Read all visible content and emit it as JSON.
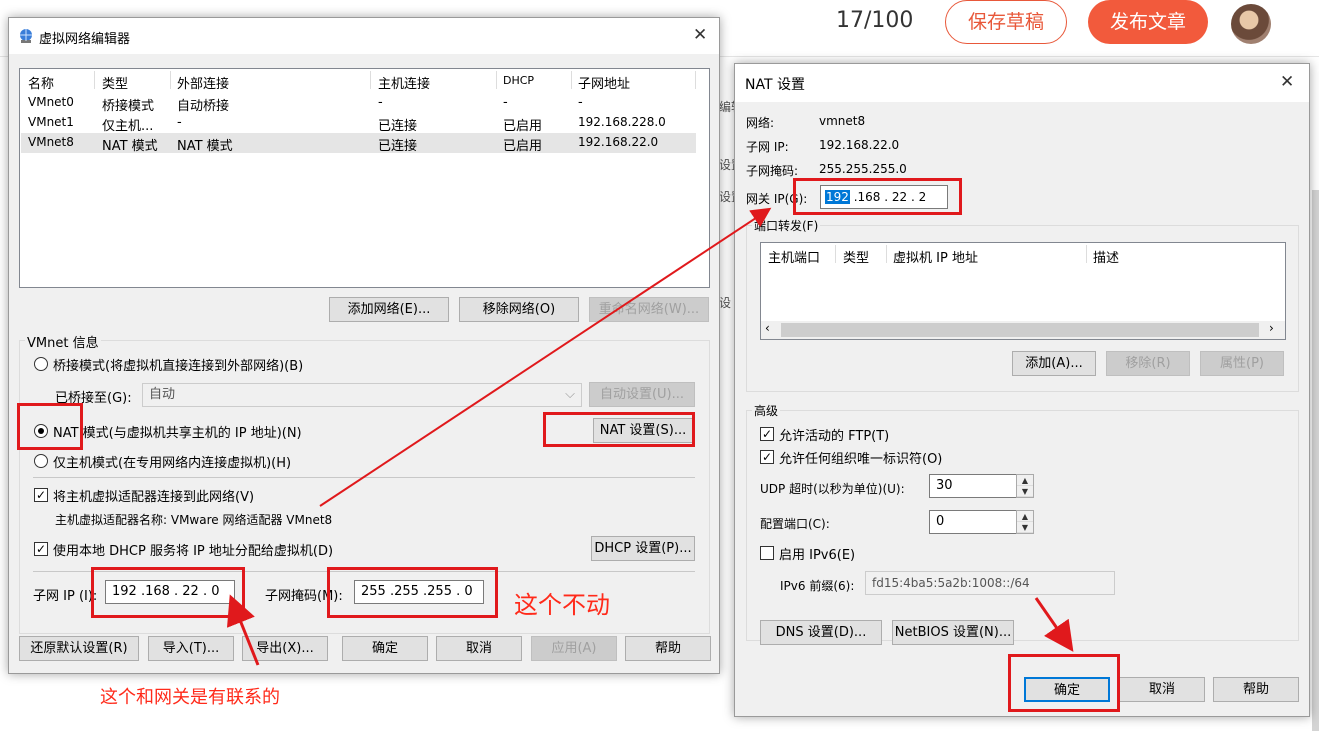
{
  "editor": {
    "counter": "17/100",
    "save_draft": "保存草稿",
    "publish": "发布文章"
  },
  "background": {
    "frag1": "编辑",
    "frag2": "设置",
    "frag3": "设置",
    "frag4": "设"
  },
  "vne": {
    "title": "虚拟网络编辑器",
    "columns": [
      "名称",
      "类型",
      "外部连接",
      "主机连接",
      "DHCP",
      "子网地址"
    ],
    "rows": [
      [
        "VMnet0",
        "桥接模式",
        "自动桥接",
        "-",
        "-",
        "-"
      ],
      [
        "VMnet1",
        "仅主机...",
        "-",
        "已连接",
        "已启用",
        "192.168.228.0"
      ],
      [
        "VMnet8",
        "NAT 模式",
        "NAT 模式",
        "已连接",
        "已启用",
        "192.168.22.0"
      ]
    ],
    "btn_add": "添加网络(E)...",
    "btn_remove": "移除网络(O)",
    "btn_rename": "重命名网络(W)...",
    "group_label": "VMnet 信息",
    "radio_bridge": "桥接模式(将虚拟机直接连接到外部网络)(B)",
    "bridged_to": "已桥接至(G):",
    "bridged_value": "自动",
    "btn_auto": "自动设置(U)...",
    "radio_nat": "NAT 模式(与虚拟机共享主机的 IP 地址)(N)",
    "btn_nat": "NAT 设置(S)...",
    "radio_host": "仅主机模式(在专用网络内连接虚拟机)(H)",
    "chk_adapter": "将主机虚拟适配器连接到此网络(V)",
    "adapter_name": "主机虚拟适配器名称: VMware 网络适配器 VMnet8",
    "chk_dhcp": "使用本地 DHCP 服务将 IP 地址分配给虚拟机(D)",
    "btn_dhcp": "DHCP 设置(P)...",
    "subnet_ip_label": "子网 IP (I):",
    "subnet_ip": "192 .168 . 22 .  0",
    "mask_label": "子网掩码(M):",
    "mask": "255 .255 .255 .  0",
    "btn_restore": "还原默认设置(R)",
    "btn_import": "导入(T)...",
    "btn_export": "导出(X)...",
    "btn_ok": "确定",
    "btn_cancel": "取消",
    "btn_apply": "应用(A)",
    "btn_help": "帮助"
  },
  "nat": {
    "title": "NAT 设置",
    "network_label": "网络:",
    "network": "vmnet8",
    "subnet_label": "子网 IP:",
    "subnet": "192.168.22.0",
    "mask_label": "子网掩码:",
    "mask": "255.255.255.0",
    "gw_label": "网关 IP(G):",
    "gw_sel": "192",
    "gw_rest": " .168 . 22 .  2",
    "pf_label": "端口转发(F)",
    "pf_cols": [
      "主机端口",
      "类型",
      "虚拟机 IP 地址",
      "描述"
    ],
    "btn_add": "添加(A)...",
    "btn_remove": "移除(R)",
    "btn_props": "属性(P)",
    "adv_label": "高级",
    "chk_ftp": "允许活动的 FTP(T)",
    "chk_oui": "允许任何组织唯一标识符(O)",
    "udp_label": "UDP 超时(以秒为单位)(U):",
    "udp": "30",
    "cfg_label": "配置端口(C):",
    "cfg": "0",
    "chk_ipv6": "启用 IPv6(E)",
    "ipv6_label": "IPv6 前缀(6):",
    "ipv6": "fd15:4ba5:5a2b:1008::/64",
    "btn_dns": "DNS 设置(D)...",
    "btn_netbios": "NetBIOS 设置(N)...",
    "btn_ok": "确定",
    "btn_cancel": "取消",
    "btn_help": "帮助"
  },
  "annotations": {
    "no_change": "这个不动",
    "related": "这个和网关是有联系的"
  },
  "colors": {
    "accent": "#f25a3c",
    "annotation": "#e0191c",
    "selection": "#0078d7"
  }
}
